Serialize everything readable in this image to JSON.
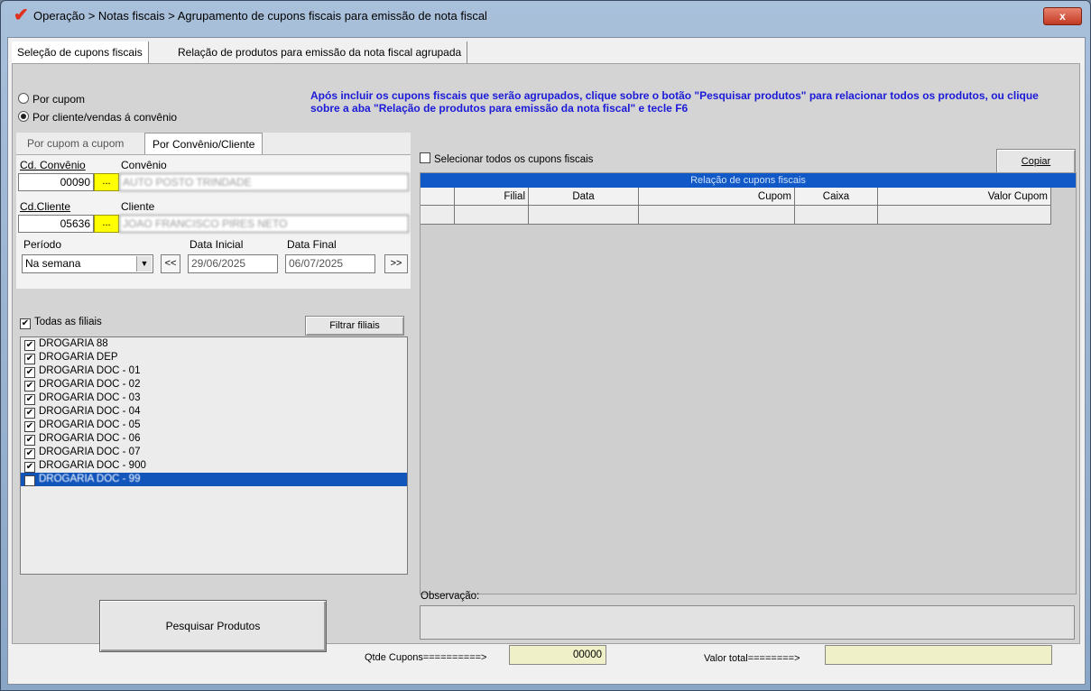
{
  "window": {
    "title": "Operação > Notas fiscais > Agrupamento de cupons fiscais para emissão de nota fiscal",
    "close_label": "x",
    "app_icon": "check-mark-icon"
  },
  "main_tabs": [
    {
      "label": "Seleção de cupons fiscais",
      "active": true
    },
    {
      "label": "Relação de produtos para emissão da nota fiscal agrupada",
      "active": false
    }
  ],
  "mode": {
    "option_cupom": "Por cupom",
    "option_cliente": "Por cliente/vendas á convênio",
    "selected": "cliente"
  },
  "instruction": "Após incluir os cupons fiscais que serão agrupados, clique sobre o botão \"Pesquisar produtos\" para relacionar todos os produtos, ou clique sobre a aba \"Relação de produtos para emissão da nota fiscal\" e tecle F6",
  "sub_tabs": [
    {
      "label": "Por cupom a cupom",
      "active": false
    },
    {
      "label": "Por Convênio/Cliente",
      "active": true
    }
  ],
  "filter": {
    "cd_convenio_label": "Cd. Convênio",
    "cd_convenio_value": "00090",
    "convenio_label": "Convênio",
    "convenio_value": "AUTO POSTO TRINDADE",
    "cd_cliente_label": "Cd.Cliente",
    "cd_cliente_value": "05636",
    "cliente_label": "Cliente",
    "cliente_value": "JOAO FRANCISCO PIRES NETO",
    "lookup_label": "...",
    "periodo_label": "Período",
    "periodo_value": "Na semana",
    "prev_label": "<<",
    "next_label": ">>",
    "data_inicial_label": "Data Inicial",
    "data_inicial_value": "29/06/2025",
    "data_final_label": "Data Final",
    "data_final_value": "06/07/2025"
  },
  "filiais": {
    "todas_label": "Todas as filiais",
    "todas_checked": true,
    "filter_button": "Filtrar filiais",
    "items": [
      {
        "label": "DROGARIA 88",
        "checked": true,
        "selected": false
      },
      {
        "label": "DROGARIA DEP",
        "checked": true,
        "selected": false
      },
      {
        "label": "DROGARIA DOC - 01",
        "checked": true,
        "selected": false
      },
      {
        "label": "DROGARIA DOC - 02",
        "checked": true,
        "selected": false
      },
      {
        "label": "DROGARIA DOC - 03",
        "checked": true,
        "selected": false
      },
      {
        "label": "DROGARIA DOC - 04",
        "checked": true,
        "selected": false
      },
      {
        "label": "DROGARIA DOC - 05",
        "checked": true,
        "selected": false
      },
      {
        "label": "DROGARIA DOC - 06",
        "checked": true,
        "selected": false
      },
      {
        "label": "DROGARIA DOC - 07",
        "checked": true,
        "selected": false
      },
      {
        "label": "DROGARIA DOC - 900",
        "checked": true,
        "selected": false
      },
      {
        "label": "DROGARIA DOC - 99",
        "checked": true,
        "selected": true
      }
    ]
  },
  "cupons": {
    "copy_button": "Copiar",
    "select_all_label": "Selecionar todos os cupons fiscais",
    "grid_title": "Relação de cupons fiscais",
    "columns": [
      "Filial",
      "Data",
      "Cupom",
      "Caixa",
      "Valor Cupom"
    ]
  },
  "observacao_label": "Observação:",
  "search_button": "Pesquisar Produtos",
  "totals": {
    "qtde_label": "Qtde Cupons==========>",
    "qtde_value": "00000",
    "valor_label": "Valor total========>",
    "valor_value": ""
  }
}
